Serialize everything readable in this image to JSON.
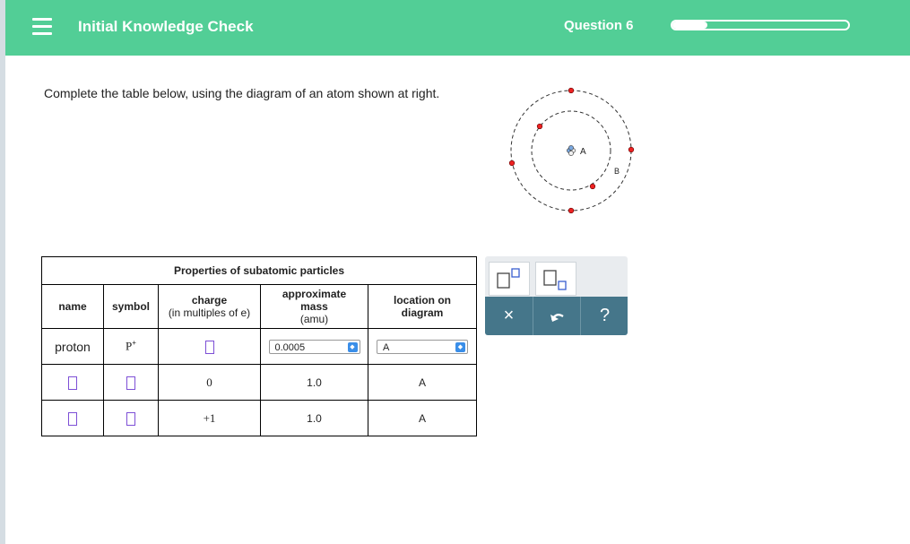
{
  "header": {
    "menu_icon": "hamburger-menu-icon",
    "title": "Initial Knowledge Check",
    "question_label": "Question 6",
    "progress_fraction": 0.2
  },
  "colors": {
    "header_bg": "#52ce96",
    "answer_box": "#7d4fd6",
    "tool_bar": "#45768a",
    "select_arrow": "#3a8ee8"
  },
  "instructions": "Complete the table below, using the diagram of an atom shown at right.",
  "diagram": {
    "label_a": "A",
    "label_b": "B"
  },
  "table": {
    "caption": "Properties of subatomic particles",
    "headers": {
      "name": "name",
      "symbol": "symbol",
      "charge": "charge",
      "charge_sub": "(in multiples of e)",
      "mass": "approximate mass",
      "mass_sub": "(amu)",
      "location": "location on diagram"
    },
    "rows": [
      {
        "name": "proton",
        "symbol": "p",
        "symbol_sup": "+",
        "charge": "",
        "mass": "0.0005",
        "location": "A"
      },
      {
        "name": "",
        "symbol": "",
        "charge": "0",
        "mass": "1.0",
        "location": "A"
      },
      {
        "name": "",
        "symbol": "",
        "charge": "+1",
        "mass": "1.0",
        "location": "A"
      }
    ]
  },
  "tools": {
    "superscript_icon": "superscript-box-icon",
    "subscript_icon": "subscript-box-icon",
    "clear_label": "×",
    "undo_icon": "undo-icon",
    "help_label": "?"
  }
}
